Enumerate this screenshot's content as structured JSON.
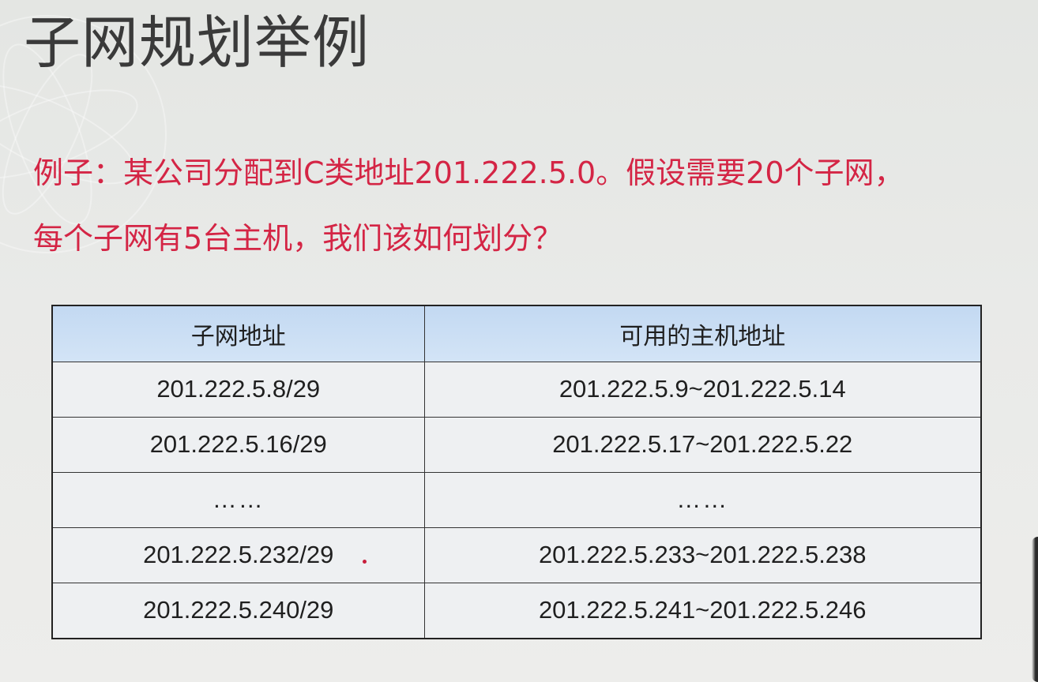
{
  "slide": {
    "title": "子网规划举例",
    "problem_line1": "例子：某公司分配到C类地址201.222.5.0。假设需要20个子网，",
    "problem_line2": "每个子网有5台主机，我们该如何划分？"
  },
  "table": {
    "headers": [
      "子网地址",
      "可用的主机地址"
    ],
    "rows": [
      [
        "201.222.5.8/29",
        "201.222.5.9~201.222.5.14"
      ],
      [
        "201.222.5.16/29",
        "201.222.5.17~201.222.5.22"
      ],
      [
        "……",
        "……"
      ],
      [
        "201.222.5.232/29",
        "201.222.5.233~201.222.5.238"
      ],
      [
        "201.222.5.240/29",
        "201.222.5.241~201.222.5.246"
      ]
    ]
  },
  "colors": {
    "title": "#3a3a3a",
    "problem_text": "#d42545",
    "header_fill": "#c9ddf3",
    "cell_fill": "#eef0f2"
  }
}
